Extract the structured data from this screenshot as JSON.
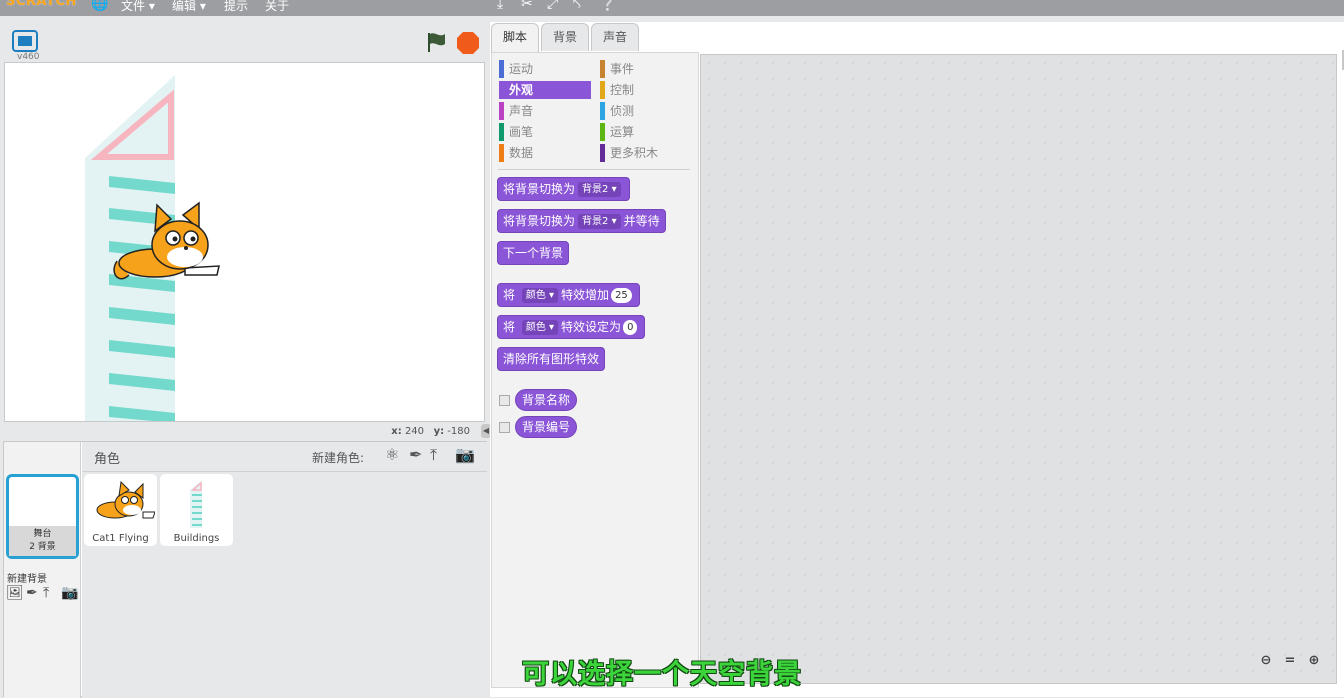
{
  "app": {
    "logo": "SCRATCH",
    "version": "v460"
  },
  "menu": {
    "file": "文件 ▾",
    "edit": "编辑 ▾",
    "tips": "提示",
    "about": "关于"
  },
  "stage": {
    "coords": {
      "x_label": "x:",
      "x_value": "240",
      "y_label": "y:",
      "y_value": "-180"
    }
  },
  "sprites": {
    "header": "角色",
    "new_sprite_label": "新建角色:",
    "stage_tile": {
      "name": "舞台",
      "backdrops": "2 背景"
    },
    "new_backdrop_label": "新建背景",
    "items": [
      {
        "name": "Cat1 Flying"
      },
      {
        "name": "Buildings"
      }
    ]
  },
  "tabs": [
    {
      "label": "脚本",
      "active": true
    },
    {
      "label": "背景",
      "active": false
    },
    {
      "label": "声音",
      "active": false
    }
  ],
  "categories": [
    {
      "label": "运动",
      "color": "#4a6cd4"
    },
    {
      "label": "事件",
      "color": "#c88330"
    },
    {
      "label": "外观",
      "color": "#8a55d7",
      "selected": true
    },
    {
      "label": "控制",
      "color": "#e1a91a"
    },
    {
      "label": "声音",
      "color": "#bb42c3"
    },
    {
      "label": "侦测",
      "color": "#2ca5e2"
    },
    {
      "label": "画笔",
      "color": "#0e9a6c"
    },
    {
      "label": "运算",
      "color": "#5cb712"
    },
    {
      "label": "数据",
      "color": "#ee7d16"
    },
    {
      "label": "更多积木",
      "color": "#632d99"
    }
  ],
  "blocks": {
    "switch_backdrop": {
      "text": "将背景切换为",
      "dropdown": "背景2"
    },
    "switch_backdrop_wait": {
      "text": "将背景切换为",
      "dropdown": "背景2",
      "suffix": "并等待"
    },
    "next_backdrop": {
      "text": "下一个背景"
    },
    "change_effect": {
      "prefix": "将",
      "dropdown": "颜色",
      "text": "特效增加",
      "value": "25"
    },
    "set_effect": {
      "prefix": "将",
      "dropdown": "颜色",
      "text": "特效设定为",
      "value": "0"
    },
    "clear_effects": {
      "text": "清除所有图形特效"
    },
    "backdrop_name": {
      "text": "背景名称"
    },
    "backdrop_number": {
      "text": "背景编号"
    }
  },
  "subtitle": "可以选择一个天空背景"
}
